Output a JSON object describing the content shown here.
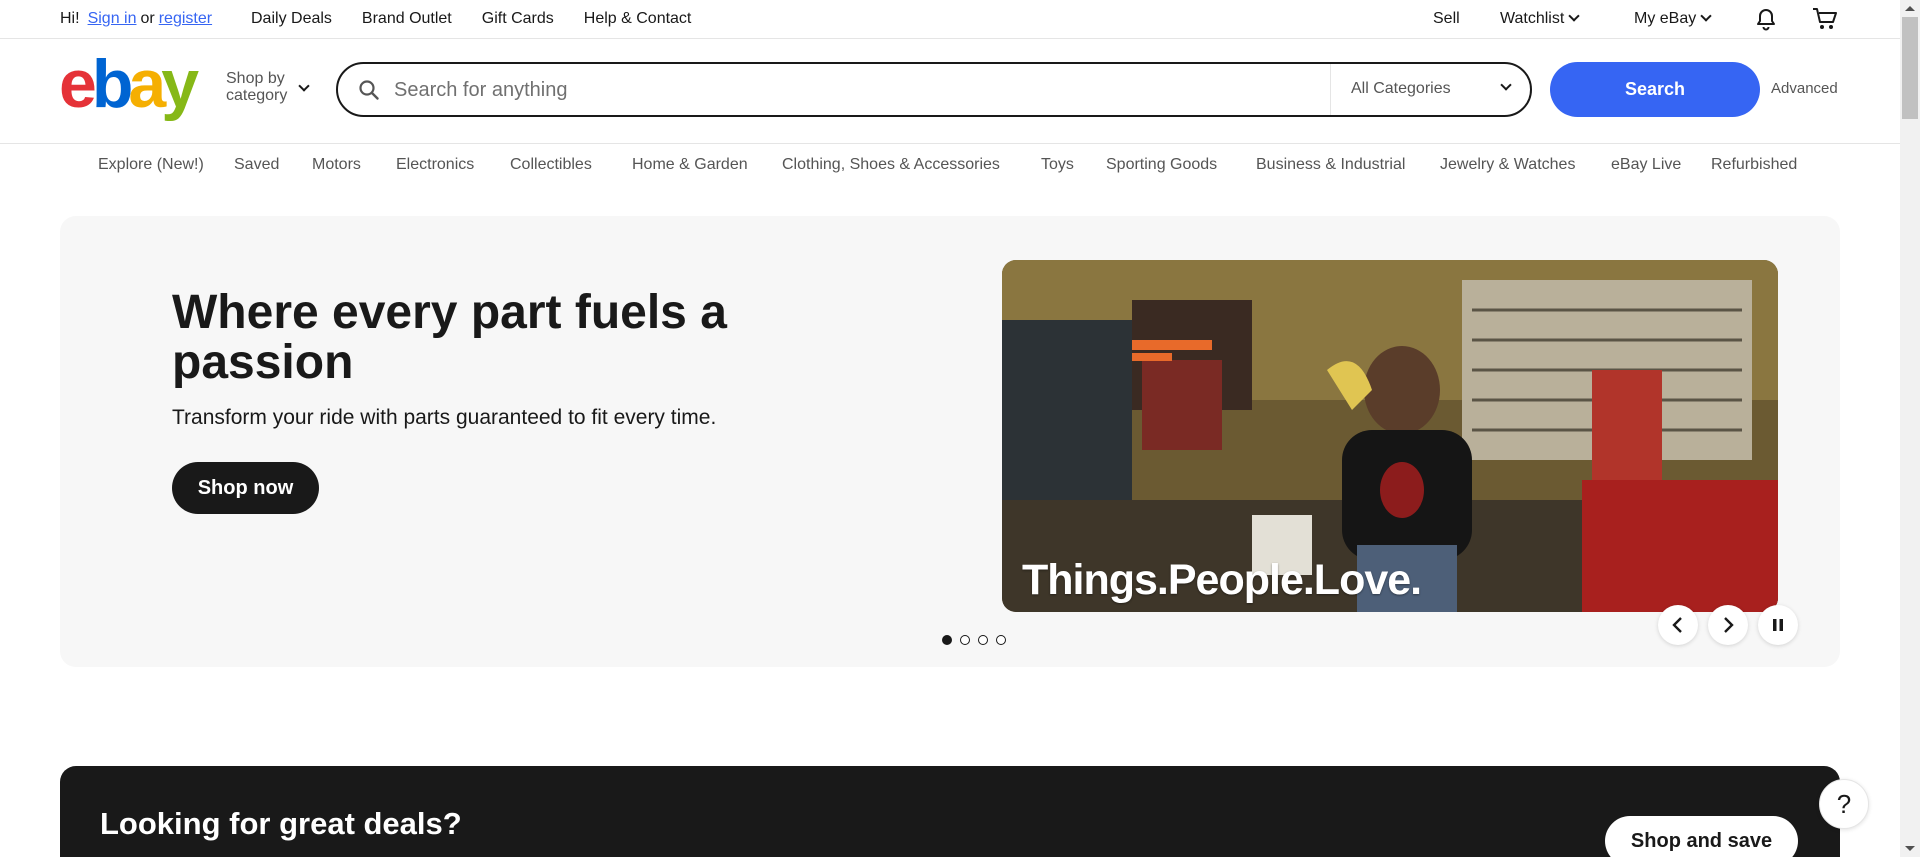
{
  "topbar": {
    "greeting": "Hi!",
    "sign_in": "Sign in",
    "or": "or",
    "register": "register",
    "links": [
      "Daily Deals",
      "Brand Outlet",
      "Gift Cards",
      "Help & Contact"
    ],
    "sell": "Sell",
    "watchlist": "Watchlist",
    "my_ebay": "My eBay"
  },
  "header": {
    "logo": {
      "e": "e",
      "b": "b",
      "a": "a",
      "y": "y"
    },
    "shop_by_1": "Shop by",
    "shop_by_2": "category",
    "search_placeholder": "Search for anything",
    "category": "All Categories",
    "search_button": "Search",
    "advanced": "Advanced"
  },
  "nav": [
    "Explore (New!)",
    "Saved",
    "Motors",
    "Electronics",
    "Collectibles",
    "Home & Garden",
    "Clothing, Shoes & Accessories",
    "Toys",
    "Sporting Goods",
    "Business & Industrial",
    "Jewelry & Watches",
    "eBay Live",
    "Refurbished"
  ],
  "hero": {
    "title": "Where every part fuels a passion",
    "subtitle": "Transform your ride with parts guaranteed to fit every time.",
    "cta": "Shop now",
    "image_tagline": "Things.People.Love.",
    "slides_count": 4,
    "active_slide": 1
  },
  "deals": {
    "title": "Looking for great deals?",
    "subtitle": "",
    "cta": "Shop and save"
  },
  "help": "?"
}
